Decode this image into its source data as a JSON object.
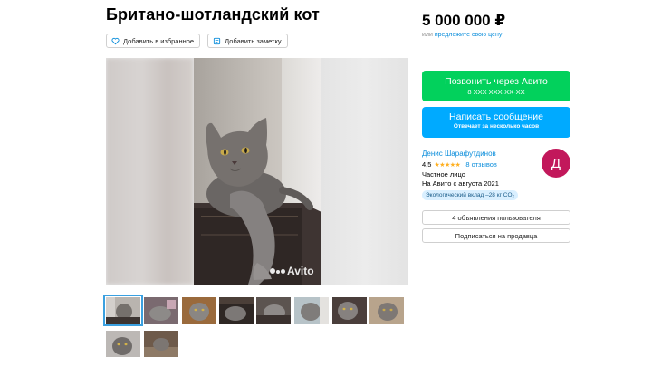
{
  "listing": {
    "title": "Британо-шотландский кот",
    "favorite_label": "Добавить в избранное",
    "note_label": "Добавить заметку"
  },
  "price": {
    "value": "5 000 000 ₽",
    "prefix": "или",
    "offer_link": "предложите свою цену"
  },
  "gallery": {
    "watermark": "Avito",
    "thumbnail_count": 10,
    "active_thumbnail": 1
  },
  "contact": {
    "call_label": "Позвонить через Авито",
    "call_phone": "8 XXX XXX-XX-XX",
    "message_label": "Написать сообщение",
    "message_sub": "Отвечает за несколько часов"
  },
  "seller": {
    "name": "Денис Шарафутдинов",
    "rating": "4,5",
    "stars": "★★★★★",
    "reviews": "8 отзывов",
    "type": "Частное лицо",
    "since": "На Авито с августа 2021",
    "eco": "Экологический вклад –28 кг CO₂",
    "avatar_letter": "Д",
    "avatar_color": "#c2185b"
  },
  "actions": {
    "user_listings": "4 объявления пользователя",
    "subscribe": "Подписаться на продавца"
  },
  "colors": {
    "call_green": "#02d15c",
    "message_blue": "#00aaff",
    "link_blue": "#0a8ddb"
  }
}
